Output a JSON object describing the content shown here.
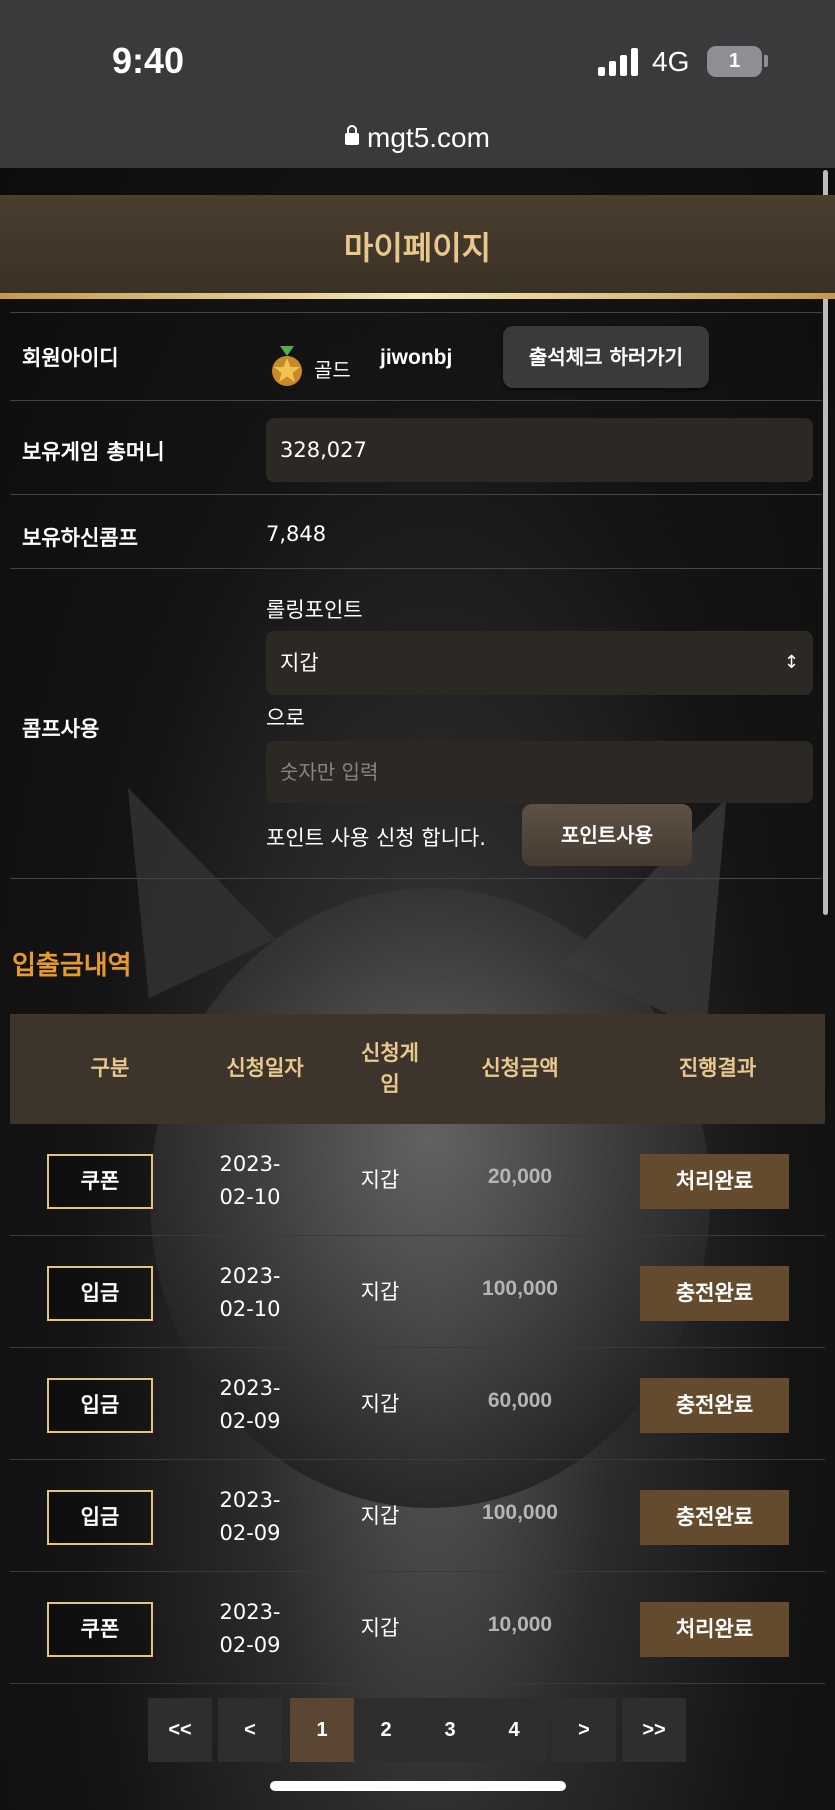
{
  "status": {
    "time": "9:40",
    "network": "4G",
    "battery": "1"
  },
  "browser": {
    "url": "mgt5.com"
  },
  "page": {
    "title": "마이페이지"
  },
  "profile": {
    "id_label": "회원아이디",
    "grade": "골드",
    "user_id": "jiwonbj",
    "attend_button": "출석체크 하러가기",
    "money_label": "보유게임 총머니",
    "money_value": "328,027",
    "comp_label": "보유하신콤프",
    "comp_value": "7,848"
  },
  "comp_use": {
    "label": "콤프사용",
    "rolling_label": "롤링포인트",
    "select_value": "지갑",
    "to_label": "으로",
    "input_placeholder": "숫자만 입력",
    "apply_text": "포인트 사용 신청 합니다.",
    "apply_button": "포인트사용"
  },
  "history": {
    "title": "입출금내역",
    "headers": [
      "구분",
      "신청일자",
      "신청게\n임",
      "신청금액",
      "진행결과"
    ],
    "rows": [
      {
        "type": "쿠폰",
        "date": "2023-\n02-10",
        "game": "지갑",
        "amount": "20,000",
        "result": "처리완료"
      },
      {
        "type": "입금",
        "date": "2023-\n02-10",
        "game": "지갑",
        "amount": "100,000",
        "result": "충전완료"
      },
      {
        "type": "입금",
        "date": "2023-\n02-09",
        "game": "지갑",
        "amount": "60,000",
        "result": "충전완료"
      },
      {
        "type": "입금",
        "date": "2023-\n02-09",
        "game": "지갑",
        "amount": "100,000",
        "result": "충전완료"
      },
      {
        "type": "쿠폰",
        "date": "2023-\n02-09",
        "game": "지갑",
        "amount": "10,000",
        "result": "처리완료"
      }
    ]
  },
  "pager": {
    "first": "<<",
    "prev": "<",
    "pages": [
      "1",
      "2",
      "3",
      "4"
    ],
    "next": ">",
    "last": ">>",
    "current": "1"
  },
  "colors": {
    "accent_gold": "#e8c88e",
    "section_orange": "#e89a2e",
    "result_brown": "#654b2e"
  }
}
